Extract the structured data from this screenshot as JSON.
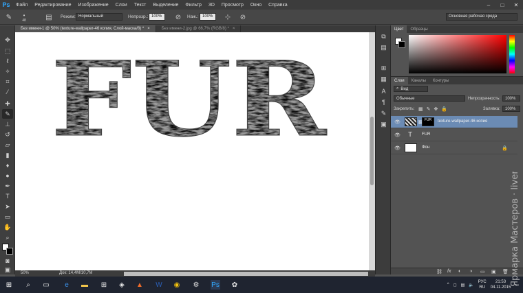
{
  "app": {
    "logo": "Ps"
  },
  "menu": [
    "Файл",
    "Редактирование",
    "Изображение",
    "Слои",
    "Текст",
    "Выделение",
    "Фильтр",
    "3D",
    "Просмотр",
    "Окно",
    "Справка"
  ],
  "window_controls": [
    "–",
    "□",
    "✕"
  ],
  "options_bar": {
    "brush_size": "48",
    "mode_label": "Режим:",
    "mode_value": "Нормальный",
    "opacity_label": "Непрозр.:",
    "opacity_value": "100%",
    "flow_label": "Наж.:",
    "flow_value": "100%",
    "workspace": "Основная рабочая среда"
  },
  "tabs": [
    {
      "label": "Без имени-1 @ 50% (texture-wallpaper-46 копия, Слой-маска/8) *",
      "active": true
    },
    {
      "label": "Без имени-2.jpg @ 66,7% (RGB/8) *",
      "active": false
    }
  ],
  "canvas": {
    "text": "FUR"
  },
  "status": {
    "zoom": "50%",
    "doc": "Док: 14,4M/10,7M"
  },
  "color_panel": {
    "tabs": [
      "Цвет",
      "Образцы"
    ]
  },
  "layers_panel": {
    "tabs": [
      "Слои",
      "Каналы",
      "Контуры"
    ],
    "filter_label": "Вид",
    "blend_mode": "Обычные",
    "opacity_label": "Непрозрачность:",
    "opacity_value": "100%",
    "lock_label": "Закрепить:",
    "fill_label": "Заливка:",
    "fill_value": "100%",
    "layers": [
      {
        "name": "texture-wallpaper-46 копия",
        "type": "image-mask",
        "selected": true
      },
      {
        "name": "FUR",
        "type": "text",
        "selected": false
      },
      {
        "name": "Фон",
        "type": "background",
        "selected": false,
        "locked": true
      }
    ],
    "bottom_icons": [
      "⛓",
      "fx",
      "◐",
      "◑",
      "▭",
      "▣",
      "🗑"
    ]
  },
  "taskbar": {
    "lang": "РУС",
    "lang_sub": "RU",
    "time": "21:53",
    "date": "04.11.2015"
  },
  "watermark": "Ярмарка Мастеров · livemaster.ru"
}
